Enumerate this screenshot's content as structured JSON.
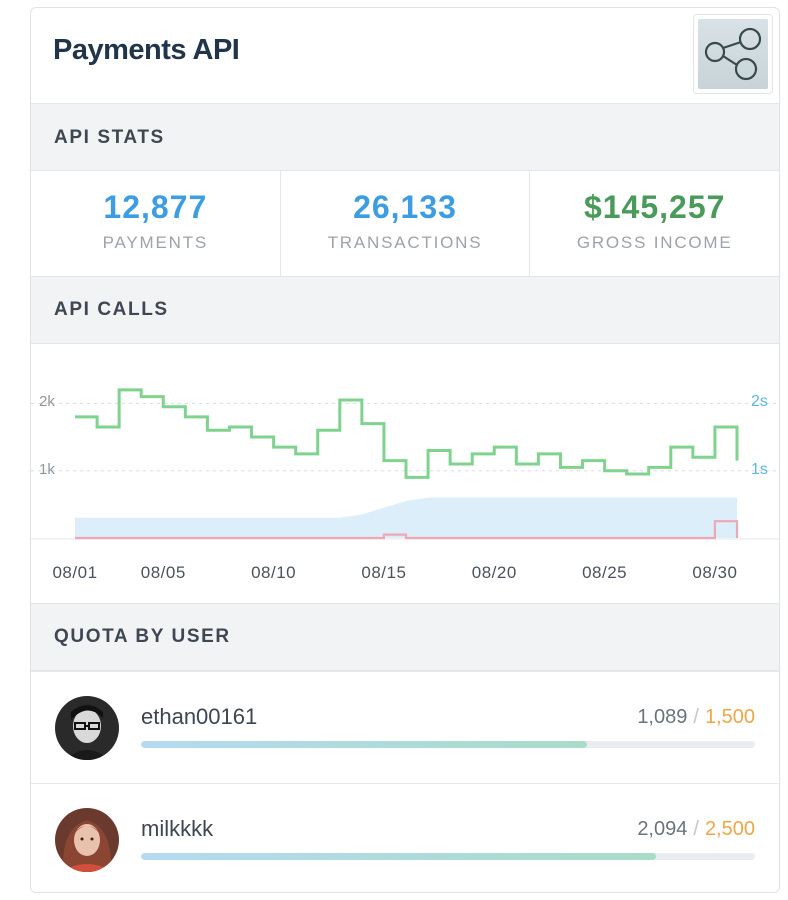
{
  "header": {
    "title": "Payments API",
    "share_icon": "share-icon"
  },
  "sections": {
    "stats_title": "API STATS",
    "calls_title": "API CALLS",
    "quota_title": "QUOTA BY USER"
  },
  "stats": [
    {
      "value": "12,877",
      "label": "PAYMENTS",
      "color": "#3d9de2"
    },
    {
      "value": "26,133",
      "label": "TRANSACTIONS",
      "color": "#3d9de2"
    },
    {
      "value": "$145,257",
      "label": "GROSS INCOME",
      "color": "#4a9a5a"
    }
  ],
  "chart_data": {
    "type": "line",
    "x": [
      "08/01",
      "08/02",
      "08/03",
      "08/04",
      "08/05",
      "08/06",
      "08/07",
      "08/08",
      "08/09",
      "08/10",
      "08/11",
      "08/12",
      "08/13",
      "08/14",
      "08/15",
      "08/16",
      "08/17",
      "08/18",
      "08/19",
      "08/20",
      "08/21",
      "08/22",
      "08/23",
      "08/24",
      "08/25",
      "08/26",
      "08/27",
      "08/28",
      "08/29",
      "08/30",
      "08/31"
    ],
    "x_ticks": [
      "08/01",
      "08/05",
      "08/10",
      "08/15",
      "08/20",
      "08/25",
      "08/30"
    ],
    "y_ticks_left": [
      "2k",
      "1k"
    ],
    "y_ticks_right": [
      "2s",
      "1s"
    ],
    "ylim_left": [
      0,
      2600
    ],
    "ylim_right": [
      0,
      2.6
    ],
    "grid": "dashed horizontal at 1k/1s and 2k/2s",
    "series": [
      {
        "color": "#7fd38e",
        "values": [
          1800,
          1650,
          2200,
          2100,
          1950,
          1800,
          1600,
          1650,
          1500,
          1350,
          1250,
          1600,
          2050,
          1700,
          1150,
          900,
          1300,
          1100,
          1250,
          1350,
          1100,
          1250,
          1050,
          1150,
          1000,
          950,
          1050,
          1350,
          1200,
          1650,
          1150
        ]
      },
      {
        "color": "#d8ecfa",
        "values": [
          0.3,
          0.3,
          0.3,
          0.3,
          0.3,
          0.3,
          0.3,
          0.3,
          0.3,
          0.3,
          0.3,
          0.3,
          0.3,
          0.35,
          0.45,
          0.55,
          0.6,
          0.6,
          0.6,
          0.6,
          0.6,
          0.6,
          0.6,
          0.6,
          0.6,
          0.6,
          0.6,
          0.6,
          0.6,
          0.6,
          0.6
        ]
      },
      {
        "color": "#eea8b4",
        "values": [
          0,
          0,
          0,
          0,
          0,
          0,
          0,
          0,
          0,
          0,
          0,
          0,
          0,
          0,
          50,
          0,
          0,
          0,
          0,
          0,
          0,
          0,
          0,
          0,
          0,
          0,
          0,
          0,
          0,
          250,
          0
        ]
      }
    ]
  },
  "users": [
    {
      "name": "ethan00161",
      "used": "1,089",
      "limit": "1,500",
      "fraction": 0.726,
      "avatar_icon": "avatar-ethan"
    },
    {
      "name": "milkkkk",
      "used": "2,094",
      "limit": "2,500",
      "fraction": 0.838,
      "avatar_icon": "avatar-milkkkk"
    }
  ],
  "quota_separator": "/"
}
